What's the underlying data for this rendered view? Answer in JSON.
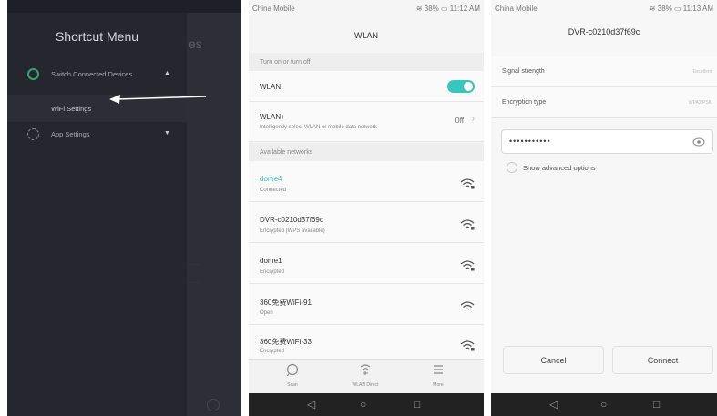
{
  "shortcut_menu": {
    "title": "Shortcut Menu",
    "background_ghost_text": "es",
    "items": [
      {
        "label": "Switch Connected Devices",
        "expanded": true
      },
      {
        "label": "WiFi Settings"
      },
      {
        "label": "App Settings",
        "expanded": false
      }
    ]
  },
  "wlan_screen": {
    "status": {
      "carrier": "China Mobile",
      "battery": "38%",
      "time": "11:12 AM"
    },
    "title": "WLAN",
    "section_toggle": "Turn on or turn off",
    "wlan_label": "WLAN",
    "wlan_on": true,
    "wlan_plus": {
      "label": "WLAN+",
      "desc": "Intelligently select WLAN or mobile data network",
      "value": "Off"
    },
    "section_networks": "Available networks",
    "networks": [
      {
        "name": "dome4",
        "status": "Connected"
      },
      {
        "name": "DVR-c0210d37f69c",
        "status": "Encrypted (WPS available)"
      },
      {
        "name": "dome1",
        "status": "Encrypted"
      },
      {
        "name": "360免费WiFi-91",
        "status": "Open"
      },
      {
        "name": "360免费WiFi-33",
        "status": "Encrypted"
      }
    ],
    "tabs": [
      "Scan",
      "WLAN Direct",
      "More"
    ]
  },
  "detail_screen": {
    "status": {
      "carrier": "China Mobile",
      "battery": "38%",
      "time": "11:13 AM"
    },
    "title": "DVR-c0210d37f69c",
    "signal_label": "Signal strength",
    "signal_value": "Excellent",
    "encryption_label": "Encryption type",
    "encryption_value": "WPA2 PSK",
    "password_masked": "•••••••••••",
    "advanced_label": "Show advanced options",
    "cancel_label": "Cancel",
    "connect_label": "Connect"
  },
  "colors": {
    "accent": "#38c6bd",
    "connected": "#3bb8c0",
    "drawer_bg": "#25262e"
  }
}
